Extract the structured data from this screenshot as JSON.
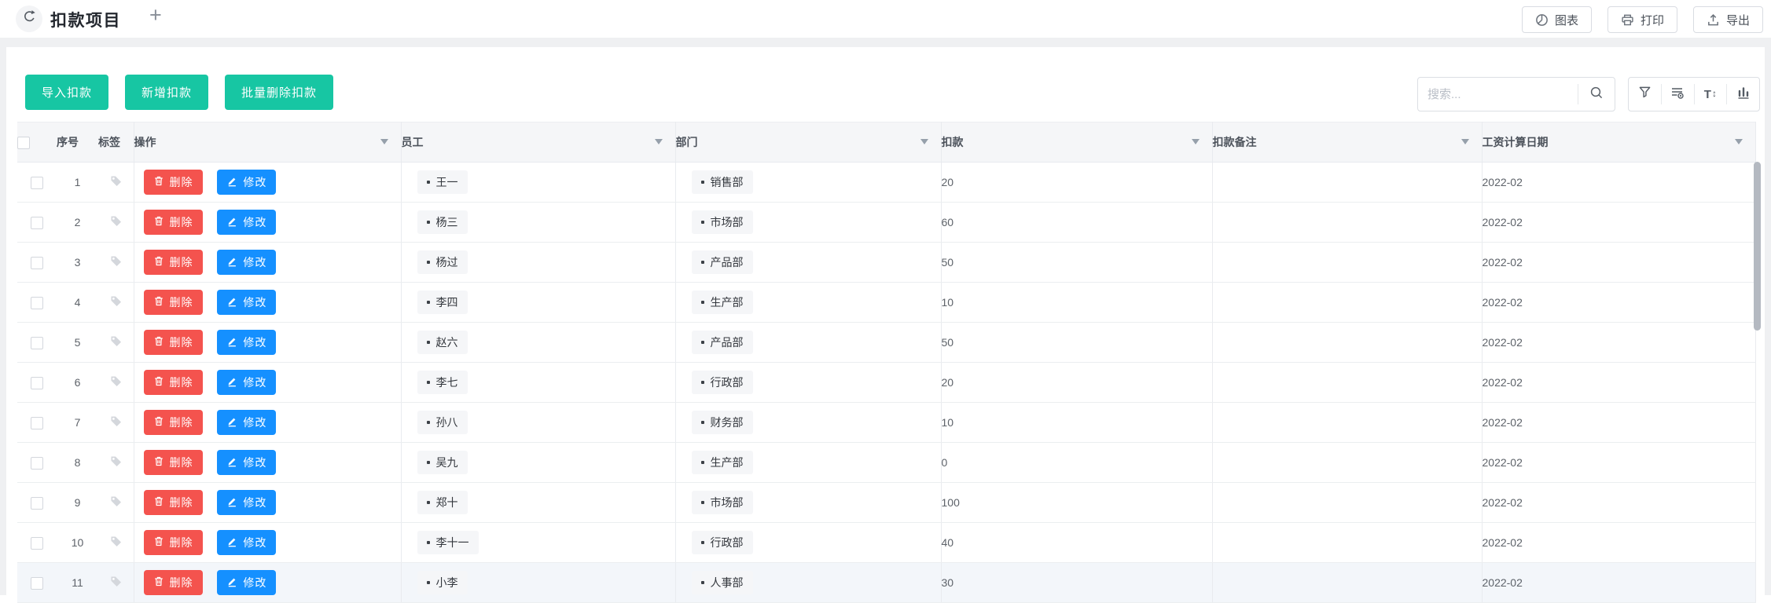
{
  "colors": {
    "accent_teal": "#17C6A3",
    "danger_red": "#F4534E",
    "primary_blue": "#1590FF",
    "table_header_bg": "#F5F6F8",
    "row_highlight_bg": "#F3F6FA",
    "border": "#EBEEF0"
  },
  "topbar": {
    "title": "扣款项目",
    "new_tab_label": "+",
    "buttons": [
      {
        "icon": "pie-chart-icon",
        "label": "图表"
      },
      {
        "icon": "printer-icon",
        "label": "打印"
      },
      {
        "icon": "export-icon",
        "label": "导出"
      }
    ]
  },
  "toolbar": {
    "import_label": "导入扣款",
    "add_label": "新增扣款",
    "batch_delete_label": "批量删除扣款",
    "search_placeholder": "搜索...",
    "tool_icons": [
      "filter-icon",
      "table-settings-icon",
      "text-size-icon",
      "column-chart-icon"
    ]
  },
  "table": {
    "columns": [
      {
        "label": "",
        "filter": false
      },
      {
        "label": "序号",
        "filter": false
      },
      {
        "label": "标签",
        "filter": false
      },
      {
        "label": "操作",
        "filter": true
      },
      {
        "label": "员工",
        "filter": true
      },
      {
        "label": "部门",
        "filter": true
      },
      {
        "label": "扣款",
        "filter": true
      },
      {
        "label": "扣款备注",
        "filter": true
      },
      {
        "label": "工资计算日期",
        "filter": true
      }
    ],
    "actions": {
      "delete_label": "删除",
      "edit_label": "修改"
    },
    "rows": [
      {
        "index": "1",
        "employee": "王一",
        "department": "销售部",
        "amount": "20",
        "note": "",
        "date": "2022-02",
        "highlighted": false
      },
      {
        "index": "2",
        "employee": "杨三",
        "department": "市场部",
        "amount": "60",
        "note": "",
        "date": "2022-02",
        "highlighted": false
      },
      {
        "index": "3",
        "employee": "杨过",
        "department": "产品部",
        "amount": "50",
        "note": "",
        "date": "2022-02",
        "highlighted": false
      },
      {
        "index": "4",
        "employee": "李四",
        "department": "生产部",
        "amount": "10",
        "note": "",
        "date": "2022-02",
        "highlighted": false
      },
      {
        "index": "5",
        "employee": "赵六",
        "department": "产品部",
        "amount": "50",
        "note": "",
        "date": "2022-02",
        "highlighted": false
      },
      {
        "index": "6",
        "employee": "李七",
        "department": "行政部",
        "amount": "20",
        "note": "",
        "date": "2022-02",
        "highlighted": false
      },
      {
        "index": "7",
        "employee": "孙八",
        "department": "财务部",
        "amount": "10",
        "note": "",
        "date": "2022-02",
        "highlighted": false
      },
      {
        "index": "8",
        "employee": "吴九",
        "department": "生产部",
        "amount": "0",
        "note": "",
        "date": "2022-02",
        "highlighted": false
      },
      {
        "index": "9",
        "employee": "郑十",
        "department": "市场部",
        "amount": "100",
        "note": "",
        "date": "2022-02",
        "highlighted": false
      },
      {
        "index": "10",
        "employee": "李十一",
        "department": "行政部",
        "amount": "40",
        "note": "",
        "date": "2022-02",
        "highlighted": false
      },
      {
        "index": "11",
        "employee": "小李",
        "department": "人事部",
        "amount": "30",
        "note": "",
        "date": "2022-02",
        "highlighted": true
      }
    ]
  }
}
